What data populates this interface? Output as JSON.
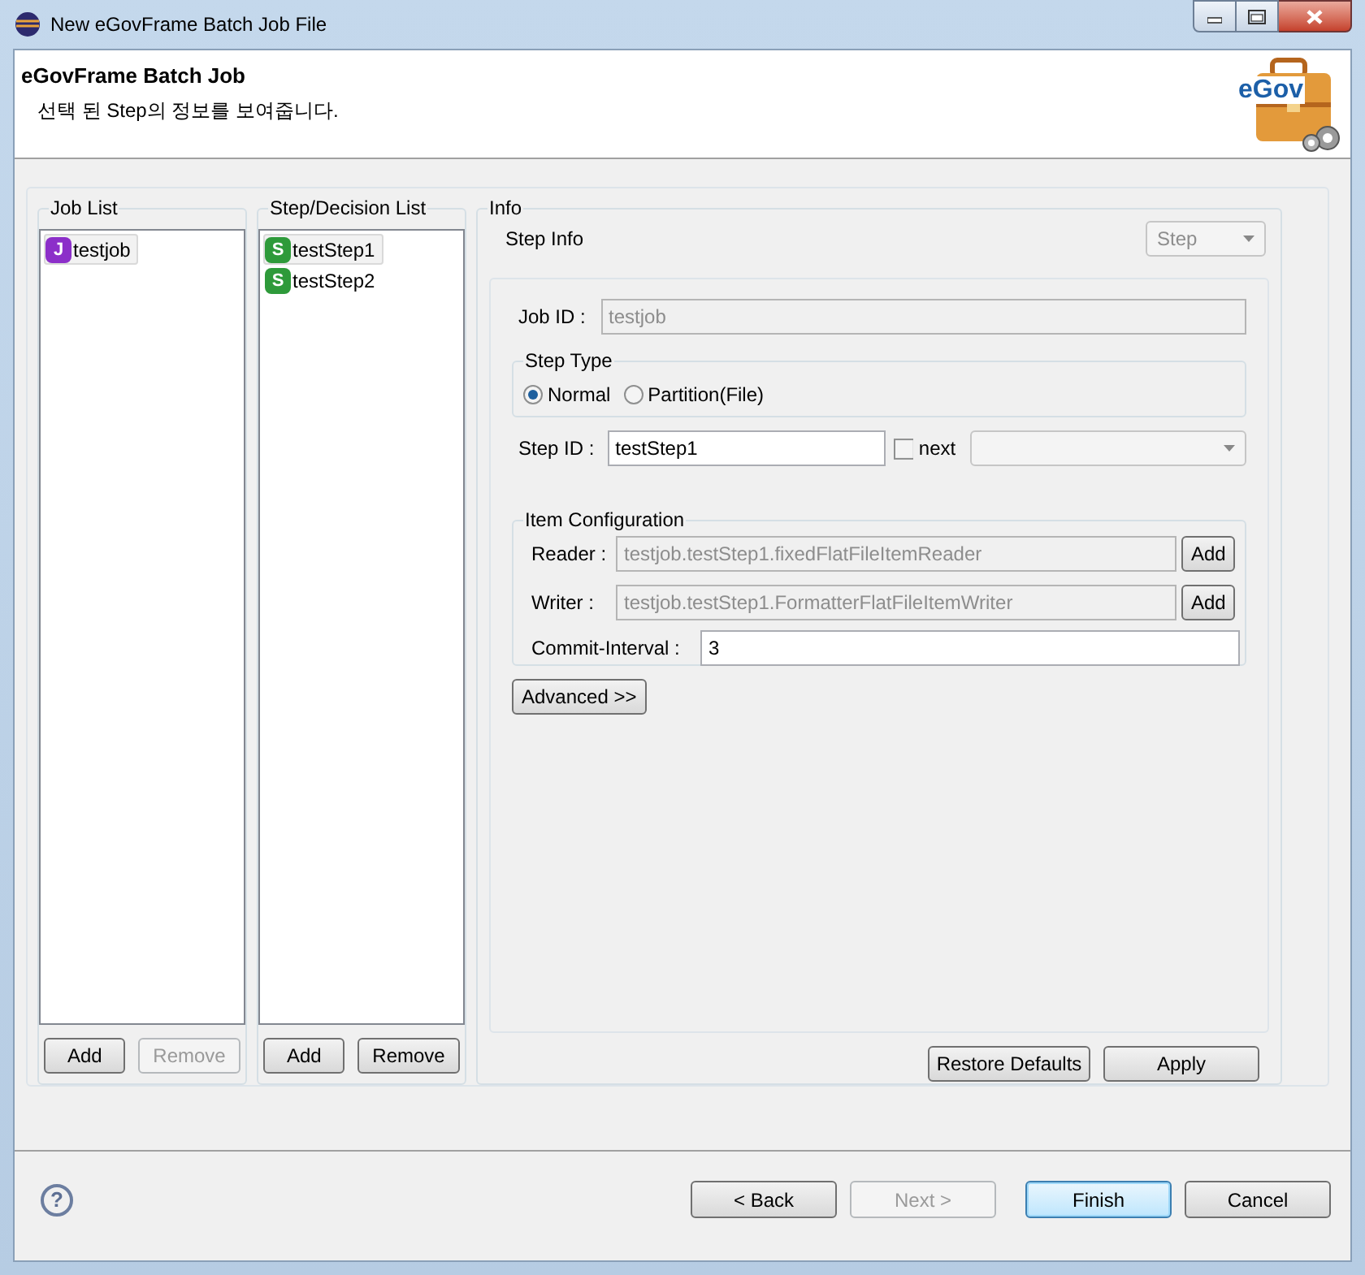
{
  "window": {
    "title": "New eGovFrame Batch Job File"
  },
  "header": {
    "title": "eGovFrame Batch Job",
    "description": "선택 된 Step의 정보를 보여줍니다.",
    "logo": "eGov"
  },
  "job_list": {
    "title": "Job List",
    "items": [
      {
        "badge": "J",
        "label": "testjob",
        "selected": true
      }
    ],
    "buttons": [
      {
        "label": "Add",
        "disabled": false
      },
      {
        "label": "Remove",
        "disabled": true
      }
    ]
  },
  "step_list": {
    "title": "Step/Decision List",
    "items": [
      {
        "badge": "S",
        "label": "testStep1",
        "selected": true
      },
      {
        "badge": "S",
        "label": "testStep2",
        "selected": false
      }
    ],
    "buttons": [
      {
        "label": "Add",
        "disabled": false
      },
      {
        "label": "Remove",
        "disabled": false
      }
    ]
  },
  "info": {
    "title": "Info",
    "subtitle": "Step Info",
    "type_select": {
      "value": "Step",
      "disabled": true
    },
    "job_id": {
      "label": "Job ID :",
      "value": "testjob",
      "disabled": true
    },
    "step_type": {
      "title": "Step Type",
      "options": [
        {
          "label": "Normal",
          "selected": true
        },
        {
          "label": "Partition(File)",
          "selected": false
        }
      ]
    },
    "step_id": {
      "label": "Step ID :",
      "value": "testStep1"
    },
    "next": {
      "label": "next",
      "checked": false
    },
    "item_configuration": {
      "title": "Item Configuration",
      "rows": [
        {
          "label": "Reader :",
          "value": "testjob.testStep1.fixedFlatFileItemReader",
          "disabled": true,
          "button": "Add"
        },
        {
          "label": "Writer :",
          "value": "testjob.testStep1.FormatterFlatFileItemWriter",
          "disabled": true,
          "button": "Add"
        }
      ],
      "commit_interval": {
        "label": "Commit-Interval :",
        "value": "3"
      }
    },
    "advanced_button": "Advanced >>",
    "buttons": [
      {
        "label": "Restore Defaults"
      },
      {
        "label": "Apply"
      }
    ]
  },
  "footer": {
    "help": "?",
    "buttons": [
      {
        "label": "< Back",
        "disabled": false,
        "default": false
      },
      {
        "label": "Next >",
        "disabled": true,
        "default": false
      },
      {
        "label": "Finish",
        "disabled": false,
        "default": true
      },
      {
        "label": "Cancel",
        "disabled": false,
        "default": false
      }
    ]
  }
}
